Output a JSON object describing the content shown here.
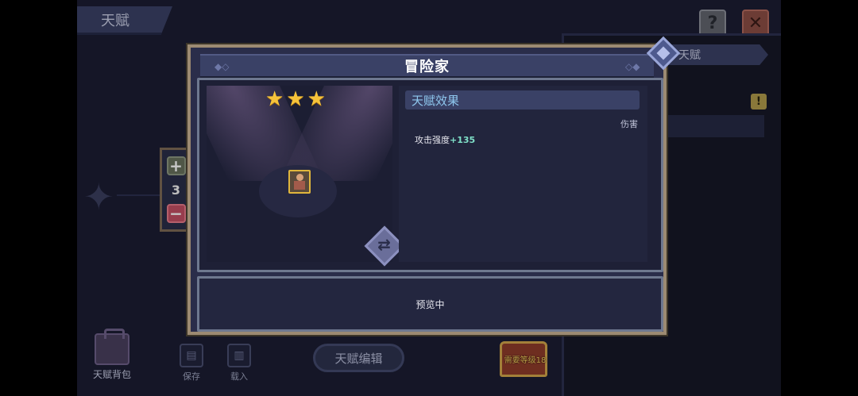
{
  "background": {
    "top_tab_label": "天赋",
    "right_panel": {
      "header_label": "天赋",
      "badge": "!"
    },
    "counter": {
      "plus": "+",
      "value": "3",
      "minus": "−"
    },
    "bottom_bar": {
      "bag_label": "天赋背包",
      "save_label": "保存",
      "load_label": "载入",
      "edit_label": "天赋编辑",
      "chest_label": "需要等级18"
    },
    "icons": {
      "help": "?",
      "close": "✕"
    }
  },
  "modal": {
    "title": "冒险家",
    "stars": 3,
    "effect": {
      "heading": "天赋效果",
      "tag": "伤害",
      "stat_label": "攻击强度",
      "stat_bonus": "+135"
    },
    "status": "预览中"
  },
  "colors": {
    "star": "#f6c33a",
    "frame": "#9c8a72",
    "bonus": "#7fe0c8",
    "effect_heading": "#8fc8ef"
  }
}
